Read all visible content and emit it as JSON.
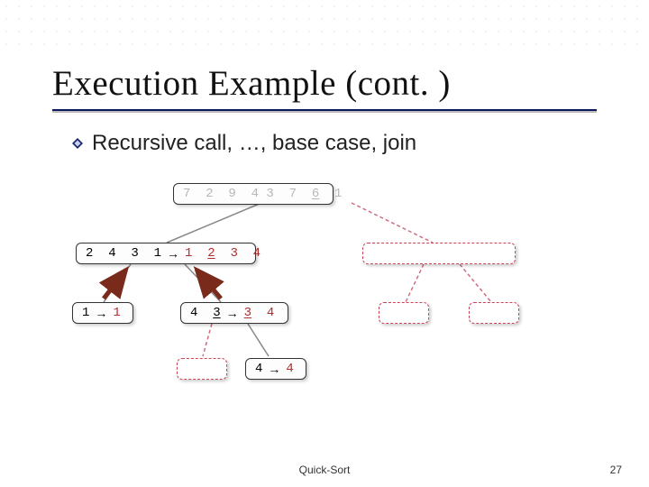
{
  "slide": {
    "title": "Execution Example (cont. )",
    "bullet": "Recursive call, …, base case, join",
    "footer": "Quick-Sort",
    "page_number": "27"
  },
  "tree": {
    "root": {
      "input": "7  2  9  4 3  7  6  1",
      "underline_index": 6
    },
    "left": {
      "input": "2  4  3  1",
      "arrow": "→",
      "output": "1  2  3  4",
      "underline_output_index": 1
    },
    "leftleft": {
      "input": "1",
      "arrow": "→",
      "output": "1"
    },
    "leftright": {
      "input": "4  3",
      "underline_index": 1,
      "arrow": "→",
      "output": "3  4",
      "underline_output_index": 0
    },
    "lr_right": {
      "input": "4",
      "arrow": "→",
      "output": "4"
    }
  }
}
